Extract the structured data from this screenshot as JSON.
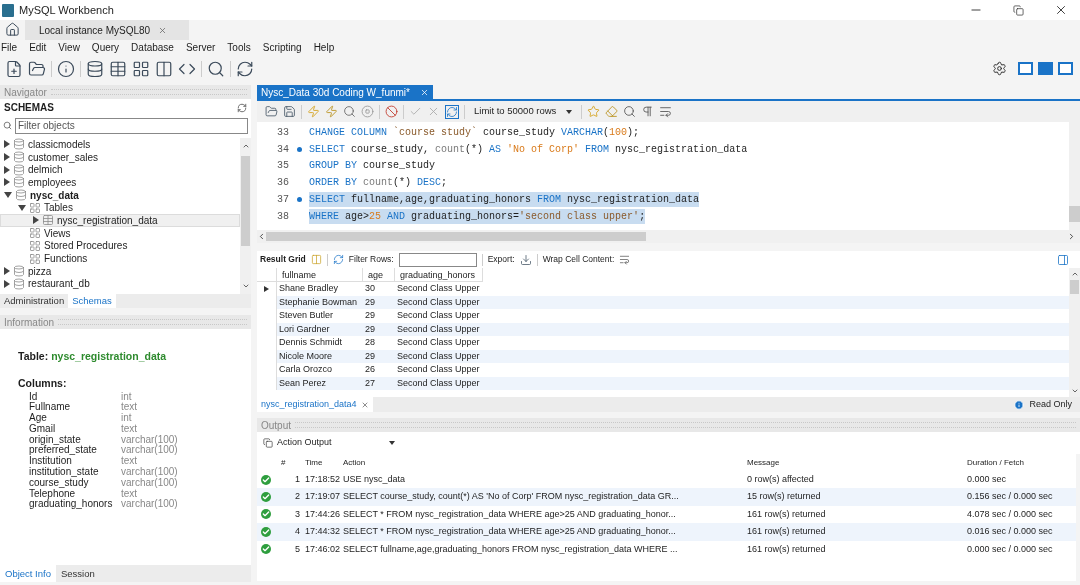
{
  "window": {
    "title": "MySQL Workbench"
  },
  "connection_tabs": [
    {
      "label": "Local instance MySQL80",
      "selected": true
    }
  ],
  "menu": [
    "File",
    "Edit",
    "View",
    "Query",
    "Database",
    "Server",
    "Tools",
    "Scripting",
    "Help"
  ],
  "navigator": {
    "title": "Navigator",
    "heading": "SCHEMAS",
    "filter": {
      "placeholder": "Filter objects"
    },
    "tree": [
      {
        "label": "classicmodels",
        "kind": "schema",
        "expanded": false,
        "default": false
      },
      {
        "label": "customer_sales",
        "kind": "schema",
        "expanded": false,
        "default": false
      },
      {
        "label": "delmich",
        "kind": "schema",
        "expanded": false,
        "default": false
      },
      {
        "label": "employees",
        "kind": "schema",
        "expanded": false,
        "default": false
      },
      {
        "label": "nysc_data",
        "kind": "schema",
        "expanded": true,
        "default": true,
        "children": [
          {
            "label": "Tables",
            "kind": "folder",
            "expanded": true,
            "children": [
              {
                "label": "nysc_registration_data",
                "kind": "table",
                "expanded": false,
                "selected": true
              }
            ]
          },
          {
            "label": "Views",
            "kind": "folder"
          },
          {
            "label": "Stored Procedures",
            "kind": "folder"
          },
          {
            "label": "Functions",
            "kind": "folder"
          }
        ]
      },
      {
        "label": "pizza",
        "kind": "schema",
        "expanded": false,
        "default": false
      },
      {
        "label": "restaurant_db",
        "kind": "schema",
        "expanded": false,
        "default": false
      }
    ],
    "tabs": [
      {
        "label": "Administration",
        "selected": false
      },
      {
        "label": "Schemas",
        "selected": true
      }
    ]
  },
  "information": {
    "title": "Information",
    "table_label": "Table:",
    "table_name": "nysc_registration_data",
    "columns_label": "Columns:",
    "columns": [
      {
        "name": "Id",
        "type": "int"
      },
      {
        "name": "Fullname",
        "type": "text"
      },
      {
        "name": "Age",
        "type": "int"
      },
      {
        "name": "Gmail",
        "type": "text"
      },
      {
        "name": "origin_state",
        "type": "varchar(100)"
      },
      {
        "name": "preferred_state",
        "type": "varchar(100)"
      },
      {
        "name": "Institution",
        "type": "text"
      },
      {
        "name": "institution_state",
        "type": "varchar(100)"
      },
      {
        "name": "course_study",
        "type": "varchar(100)"
      },
      {
        "name": "Telephone",
        "type": "text"
      },
      {
        "name": "graduating_honors",
        "type": "varchar(100)"
      }
    ],
    "tabs": [
      {
        "label": "Object Info",
        "selected": true
      },
      {
        "label": "Session",
        "selected": false
      }
    ]
  },
  "editor": {
    "tab": {
      "label": "Nysc_Data 30d Coding W_funmi*",
      "selected": true
    },
    "limit": "Limit to 50000 rows",
    "lines": [
      {
        "number": "33",
        "marker": false,
        "selected": false,
        "tokens": [
          {
            "kind": "keyword",
            "text": "CHANGE COLUMN"
          },
          {
            "kind": "string",
            "text": " `course study`"
          },
          {
            "kind": "plain",
            "text": " course_study "
          },
          {
            "kind": "keyword",
            "text": "VARCHAR"
          },
          {
            "kind": "plain",
            "text": "("
          },
          {
            "kind": "number",
            "text": "100"
          },
          {
            "kind": "plain",
            "text": ");"
          }
        ]
      },
      {
        "number": "34",
        "marker": true,
        "selected": false,
        "tokens": [
          {
            "kind": "keyword",
            "text": "SELECT"
          },
          {
            "kind": "plain",
            "text": " course_study, "
          },
          {
            "kind": "function",
            "text": "count"
          },
          {
            "kind": "plain",
            "text": "(*) "
          },
          {
            "kind": "keyword",
            "text": "AS"
          },
          {
            "kind": "number",
            "text": " 'No of Corp'"
          },
          {
            "kind": "keyword",
            "text": " FROM"
          },
          {
            "kind": "plain",
            "text": " nysc_registration_data"
          }
        ]
      },
      {
        "number": "35",
        "marker": false,
        "selected": false,
        "tokens": [
          {
            "kind": "keyword",
            "text": "GROUP BY"
          },
          {
            "kind": "plain",
            "text": " course_study"
          }
        ]
      },
      {
        "number": "36",
        "marker": false,
        "selected": false,
        "tokens": [
          {
            "kind": "keyword",
            "text": "ORDER BY"
          },
          {
            "kind": "function",
            "text": " count"
          },
          {
            "kind": "plain",
            "text": "(*) "
          },
          {
            "kind": "keyword",
            "text": "DESC"
          },
          {
            "kind": "plain",
            "text": ";"
          }
        ]
      },
      {
        "number": "37",
        "marker": true,
        "selected": true,
        "tokens": [
          {
            "kind": "keyword",
            "text": "SELECT"
          },
          {
            "kind": "plain",
            "text": " fullname,age,graduating_honors "
          },
          {
            "kind": "keyword",
            "text": "FROM"
          },
          {
            "kind": "plain",
            "text": " nysc_registration_data"
          }
        ]
      },
      {
        "number": "38",
        "marker": false,
        "selected": true,
        "tokens": [
          {
            "kind": "keyword",
            "text": "WHERE"
          },
          {
            "kind": "plain",
            "text": " age>"
          },
          {
            "kind": "number",
            "text": "25"
          },
          {
            "kind": "keyword",
            "text": " AND"
          },
          {
            "kind": "plain",
            "text": " graduating_honors="
          },
          {
            "kind": "string",
            "text": "'second class upper'"
          },
          {
            "kind": "plain",
            "text": ";"
          }
        ]
      }
    ]
  },
  "results": {
    "toolbar": {
      "label": "Result Grid",
      "filter_label": "Filter Rows:",
      "export_label": "Export:",
      "wrap_label": "Wrap Cell Content:"
    },
    "columns": [
      "fullname",
      "age",
      "graduating_honors"
    ],
    "rows": [
      {
        "current": true,
        "cells": [
          "Shane Bradley",
          "30",
          "Second Class Upper"
        ]
      },
      {
        "current": false,
        "cells": [
          "Stephanie Bowman",
          "29",
          "Second Class Upper"
        ]
      },
      {
        "current": false,
        "cells": [
          "Steven Butler",
          "29",
          "Second Class Upper"
        ]
      },
      {
        "current": false,
        "cells": [
          "Lori Gardner",
          "29",
          "Second Class Upper"
        ]
      },
      {
        "current": false,
        "cells": [
          "Dennis Schmidt",
          "28",
          "Second Class Upper"
        ]
      },
      {
        "current": false,
        "cells": [
          "Nicole Moore",
          "29",
          "Second Class Upper"
        ]
      },
      {
        "current": false,
        "cells": [
          "Carla Orozco",
          "26",
          "Second Class Upper"
        ]
      },
      {
        "current": false,
        "cells": [
          "Sean Perez",
          "27",
          "Second Class Upper"
        ]
      }
    ],
    "tab": {
      "label": "nysc_registration_data4",
      "selected": true
    },
    "status": "Read Only"
  },
  "output": {
    "title": "Output",
    "selector": "Action Output",
    "columns": [
      "#",
      "Time",
      "Action",
      "Message",
      "Duration / Fetch"
    ],
    "rows": [
      {
        "succeeded": true,
        "number": "1",
        "time": "17:18:52",
        "action": "USE nysc_data",
        "message": "0 row(s) affected",
        "duration": "0.000 sec"
      },
      {
        "succeeded": true,
        "number": "2",
        "time": "17:19:07",
        "action": "SELECT course_study, count(*) AS 'No of Corp' FROM nysc_registration_data GR...",
        "message": "15 row(s) returned",
        "duration": "0.156 sec / 0.000 sec"
      },
      {
        "succeeded": true,
        "number": "3",
        "time": "17:44:26",
        "action": "SELECT * FROM nysc_registration_data WHERE age>25 AND graduating_honor...",
        "message": "161 row(s) returned",
        "duration": "4.078 sec / 0.000 sec"
      },
      {
        "succeeded": true,
        "number": "4",
        "time": "17:44:32",
        "action": "SELECT * FROM nysc_registration_data WHERE age>25 AND graduating_honor...",
        "message": "161 row(s) returned",
        "duration": "0.016 sec / 0.000 sec"
      },
      {
        "succeeded": true,
        "number": "5",
        "time": "17:46:02",
        "action": "SELECT fullname,age,graduating_honors FROM nysc_registration_data WHERE ...",
        "message": "161 row(s) returned",
        "duration": "0.000 sec / 0.000 sec"
      }
    ]
  }
}
